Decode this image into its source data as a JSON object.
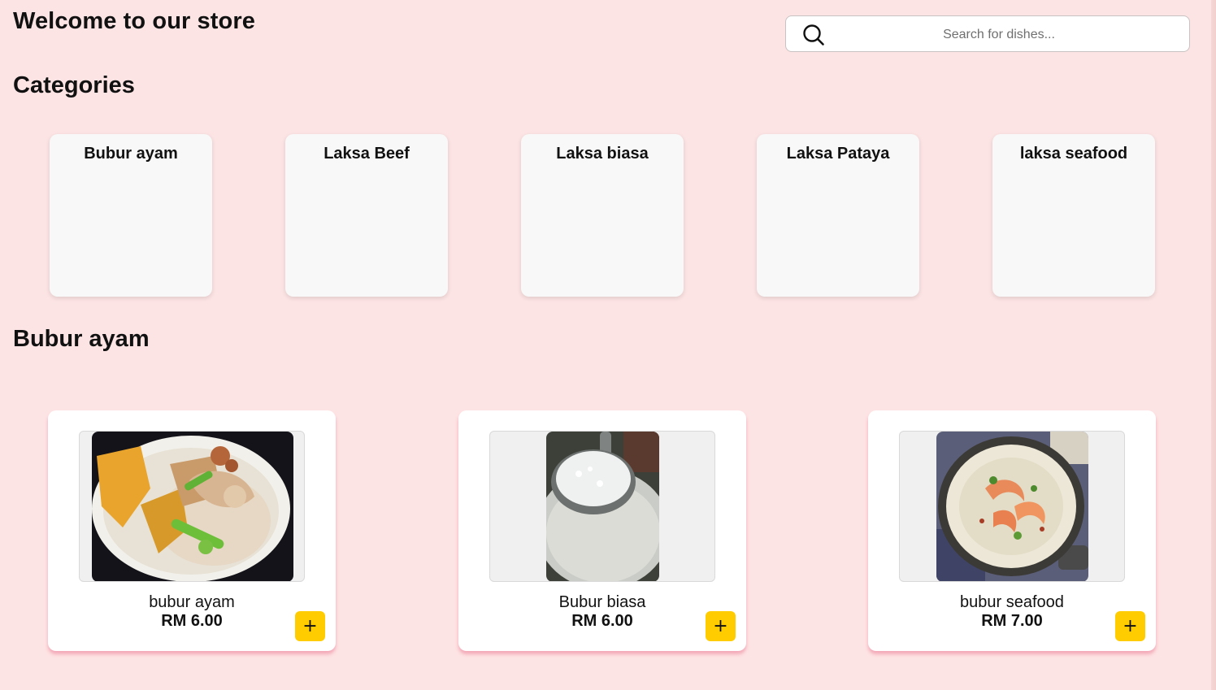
{
  "header": {
    "title": "Welcome to our store",
    "search": {
      "placeholder": "Search for dishes...",
      "value": "",
      "icon": "search-icon"
    }
  },
  "categories": {
    "heading": "Categories",
    "items": [
      {
        "label": "Bubur ayam"
      },
      {
        "label": "Laksa Beef"
      },
      {
        "label": "Laksa biasa"
      },
      {
        "label": "Laksa Pataya"
      },
      {
        "label": "laksa seafood"
      }
    ]
  },
  "menu": {
    "heading": "Bubur ayam",
    "dishes": [
      {
        "name": "bubur ayam",
        "price": "RM 6.00",
        "add_label": "+"
      },
      {
        "name": "Bubur biasa",
        "price": "RM 6.00",
        "add_label": "+"
      },
      {
        "name": "bubur seafood",
        "price": "RM 7.00",
        "add_label": "+"
      }
    ]
  },
  "colors": {
    "background": "#fde4e4",
    "card": "#ffffff",
    "category_card": "#f8f8f8",
    "add_button": "#ffcc00",
    "card_shadow": "#f096aa"
  }
}
